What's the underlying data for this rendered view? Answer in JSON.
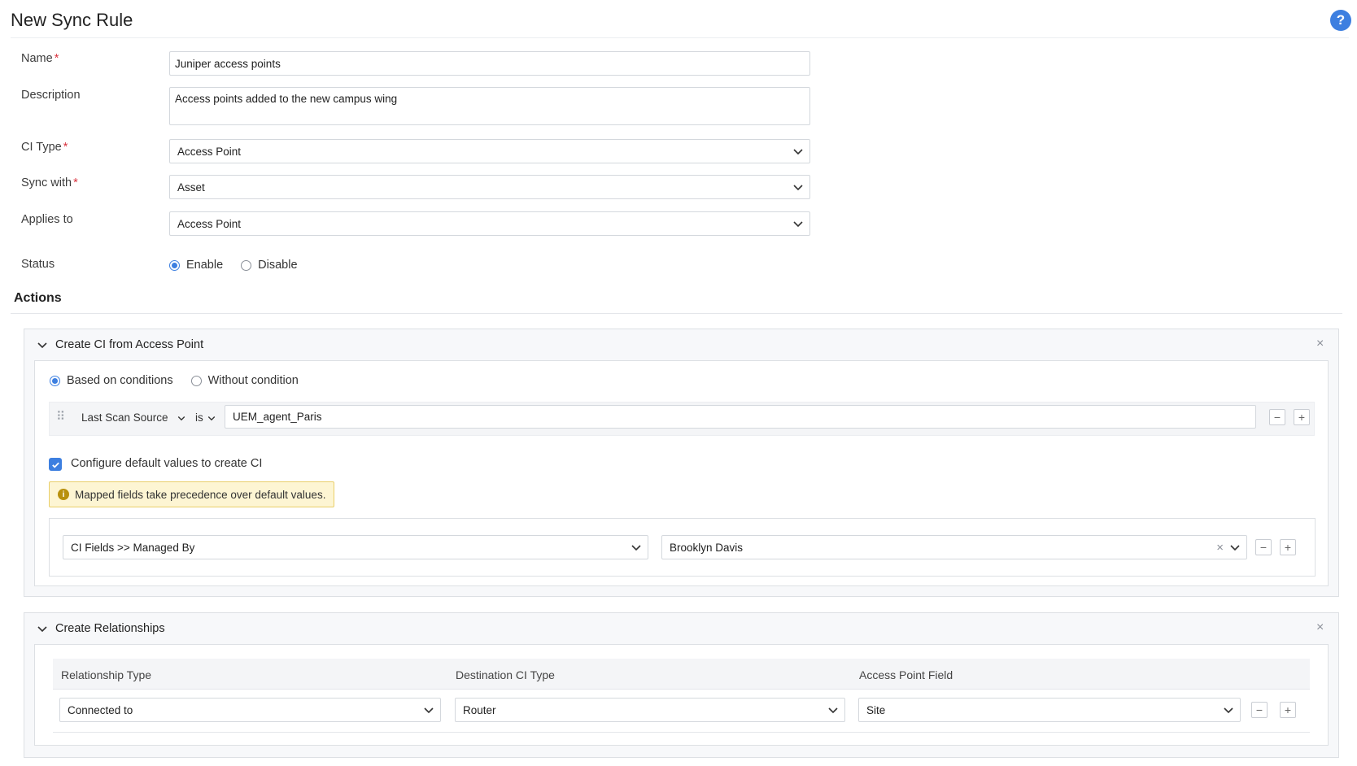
{
  "header": {
    "title": "New Sync Rule",
    "help_symbol": "?"
  },
  "form": {
    "name": {
      "label": "Name",
      "required": "*",
      "value": "Juniper access points"
    },
    "description": {
      "label": "Description",
      "value": "Access points added to the new campus wing"
    },
    "ci_type": {
      "label": "CI Type",
      "required": "*",
      "value": "Access Point"
    },
    "sync_with": {
      "label": "Sync with",
      "required": "*",
      "value": "Asset"
    },
    "applies_to": {
      "label": "Applies to",
      "value": "Access Point"
    },
    "status": {
      "label": "Status",
      "options": [
        "Enable",
        "Disable"
      ],
      "selected": "Enable"
    }
  },
  "actions": {
    "heading": "Actions",
    "create_ci": {
      "title": "Create CI from Access Point",
      "mode_options": [
        "Based on conditions",
        "Without condition"
      ],
      "mode_selected": "Based on conditions",
      "condition": {
        "field": "Last Scan Source",
        "operator": "is",
        "value": "UEM_agent_Paris"
      },
      "default_values": {
        "checkbox_label": "Configure default values to create CI",
        "checked": true,
        "note": "Mapped fields take precedence over default values.",
        "field": "CI Fields >> Managed By",
        "value": "Brooklyn Davis"
      }
    },
    "relationships": {
      "title": "Create Relationships",
      "columns": [
        "Relationship Type",
        "Destination CI Type",
        "Access Point Field"
      ],
      "row": {
        "relationship_type": "Connected to",
        "destination_ci_type": "Router",
        "access_point_field": "Site"
      }
    }
  },
  "icons": {
    "minus": "−",
    "plus": "+",
    "close": "×",
    "clear": "×",
    "drag": "⠿",
    "info": "i"
  },
  "colors": {
    "accent": "#3d7fe0",
    "required": "#d9333f",
    "note_bg": "#fdf5d3",
    "note_border": "#e9cf6a"
  }
}
